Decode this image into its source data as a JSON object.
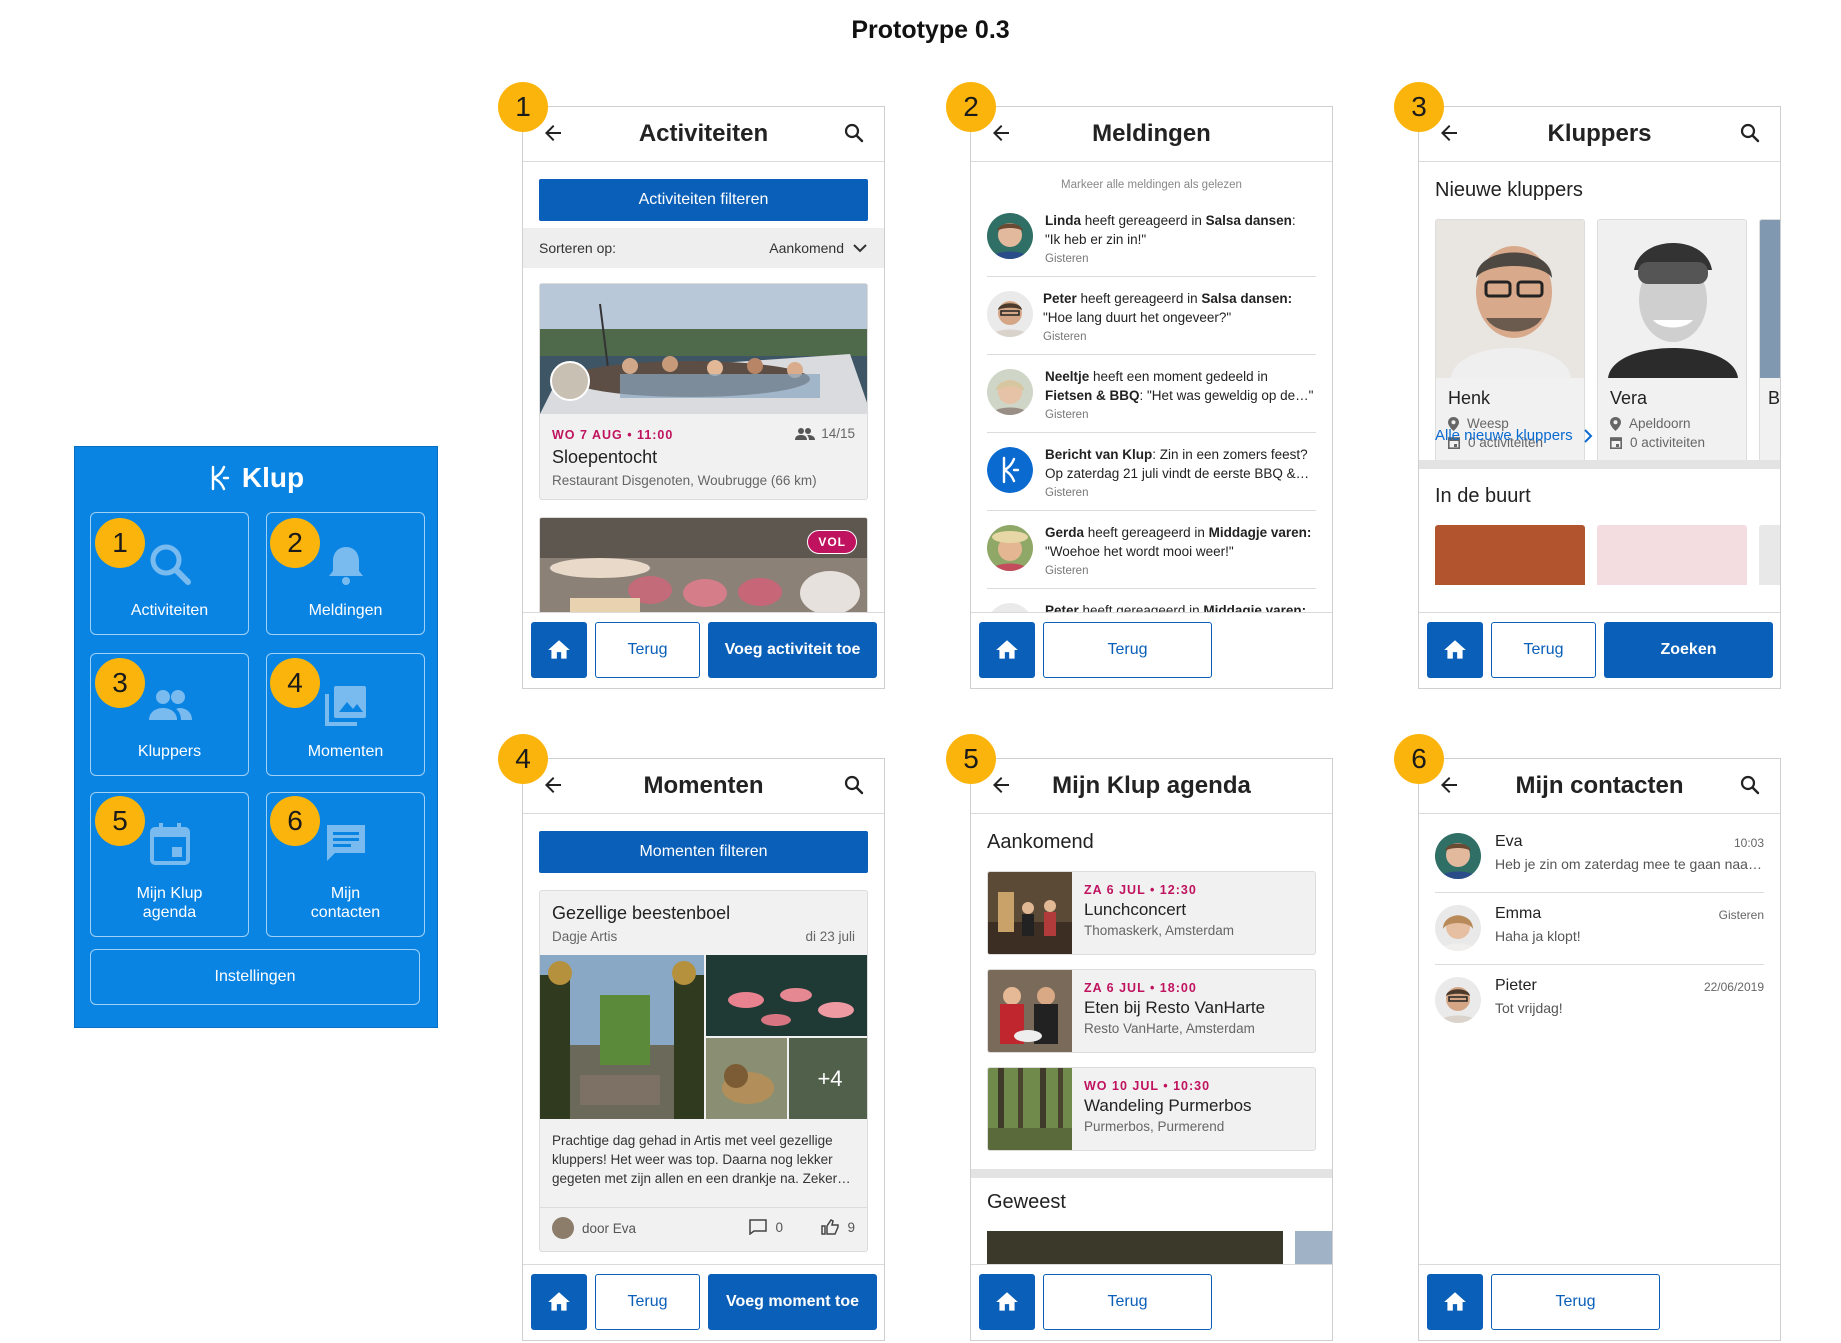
{
  "page_title": "Prototype 0.3",
  "menu": {
    "brand": "Klup",
    "tiles": [
      {
        "label": "Activiteiten",
        "badge": "1",
        "icon": "search-icon"
      },
      {
        "label": "Meldingen",
        "badge": "2",
        "icon": "bell-icon"
      },
      {
        "label": "Kluppers",
        "badge": "3",
        "icon": "people-icon"
      },
      {
        "label": "Momenten",
        "badge": "4",
        "icon": "photos-icon"
      },
      {
        "label_l1": "Mijn Klup",
        "label_l2": "agenda",
        "badge": "5",
        "icon": "calendar-icon"
      },
      {
        "label_l1": "Mijn",
        "label_l2": "contacten",
        "badge": "6",
        "icon": "chat-icon"
      }
    ],
    "settings": "Instellingen"
  },
  "screens": {
    "activiteiten": {
      "badge": "1",
      "title": "Activiteiten",
      "filter_button": "Activiteiten filteren",
      "sort_label": "Sorteren op:",
      "sort_value": "Aankomend",
      "cards": [
        {
          "date": "WO 7 AUG • 11:00",
          "capacity": "14/15",
          "title": "Sloepentocht",
          "location": "Restaurant Disgenoten, Woubrugge (66 km)"
        },
        {
          "status": "VOL"
        }
      ],
      "footer": {
        "back": "Terug",
        "action": "Voeg activiteit toe"
      }
    },
    "meldingen": {
      "badge": "2",
      "title": "Meldingen",
      "mark_all": "Markeer alle meldingen als gelezen",
      "items": [
        {
          "who": "Linda",
          "mid": " heeft gereageerd in ",
          "where": "Salsa dansen",
          "tail": ":",
          "line2": "\"Ik heb er zin in!\"",
          "time": "Gisteren"
        },
        {
          "who": "Peter",
          "mid": " heeft gereageerd in ",
          "where": "Salsa dansen:",
          "tail": "",
          "line2": "\"Hoe lang duurt het ongeveer?\"",
          "time": "Gisteren"
        },
        {
          "who": "Neeltje",
          "mid": " heeft een moment gedeeld in",
          "where": "Fietsen & BBQ",
          "tail": ": \"Het was geweldig op de…\"",
          "line2": "",
          "time": "Gisteren"
        },
        {
          "who": "Bericht van Klup",
          "mid": ": Zin in een zomers feest?",
          "where": "",
          "tail": "",
          "line2": "Op zaterdag 21 juli vindt de eerste BBQ &…",
          "time": "Gisteren"
        },
        {
          "who": "Gerda",
          "mid": " heeft gereageerd in ",
          "where": "Middagje varen:",
          "tail": "",
          "line2": "\"Woehoe het wordt mooi weer!\"",
          "time": "Gisteren"
        },
        {
          "who": "Peter",
          "mid": " heeft gereageerd in ",
          "where": "Middagje varen:",
          "tail": "",
          "line2": "",
          "time": ""
        }
      ],
      "footer": {
        "back": "Terug"
      }
    },
    "kluppers": {
      "badge": "3",
      "title": "Kluppers",
      "new_title": "Nieuwe kluppers",
      "people": [
        {
          "name": "Henk",
          "place": "Weesp",
          "activities": "0 activiteiten"
        },
        {
          "name": "Vera",
          "place": "Apeldoorn",
          "activities": "0 activiteiten"
        },
        {
          "name": "B"
        }
      ],
      "all_link": "Alle nieuwe kluppers",
      "nearby_title": "In de buurt",
      "footer": {
        "back": "Terug",
        "action": "Zoeken"
      }
    },
    "momenten": {
      "badge": "4",
      "title": "Momenten",
      "filter_button": "Momenten filteren",
      "card": {
        "title": "Gezellige beestenboel",
        "place": "Dagje Artis",
        "date": "di 23 juli",
        "more_count": "+4",
        "text": "Prachtige dag gehad in Artis met veel gezellige kluppers! Het weer was top. Daarna nog lekker gegeten met zijn allen en een drankje na. Zeker…",
        "author": "door Eva",
        "comments": "0",
        "likes": "9"
      },
      "footer": {
        "back": "Terug",
        "action": "Voeg moment toe"
      }
    },
    "agenda": {
      "badge": "5",
      "title": "Mijn Klup agenda",
      "upcoming_title": "Aankomend",
      "items": [
        {
          "date": "ZA 6 JUL • 12:30",
          "title": "Lunchconcert",
          "place": "Thomaskerk, Amsterdam"
        },
        {
          "date": "ZA 6 JUL • 18:00",
          "title": "Eten bij Resto VanHarte",
          "place": "Resto VanHarte, Amsterdam"
        },
        {
          "date": "WO 10 JUL • 10:30",
          "title": "Wandeling Purmerbos",
          "place": "Purmerbos, Purmerend"
        }
      ],
      "past_title": "Geweest",
      "footer": {
        "back": "Terug"
      }
    },
    "contacten": {
      "badge": "6",
      "title": "Mijn contacten",
      "items": [
        {
          "name": "Eva",
          "message": "Heb je zin om zaterdag mee te gaan naar…",
          "time": "10:03"
        },
        {
          "name": "Emma",
          "message": "Haha ja klopt!",
          "time": "Gisteren"
        },
        {
          "name": "Pieter",
          "message": "Tot vrijdag!",
          "time": "22/06/2019"
        }
      ],
      "footer": {
        "back": "Terug"
      }
    }
  },
  "colors": {
    "brand_blue": "#0a84e3",
    "button_blue": "#0a5fb8",
    "badge_yellow": "#fbb40b",
    "date_red": "#c0135f"
  }
}
